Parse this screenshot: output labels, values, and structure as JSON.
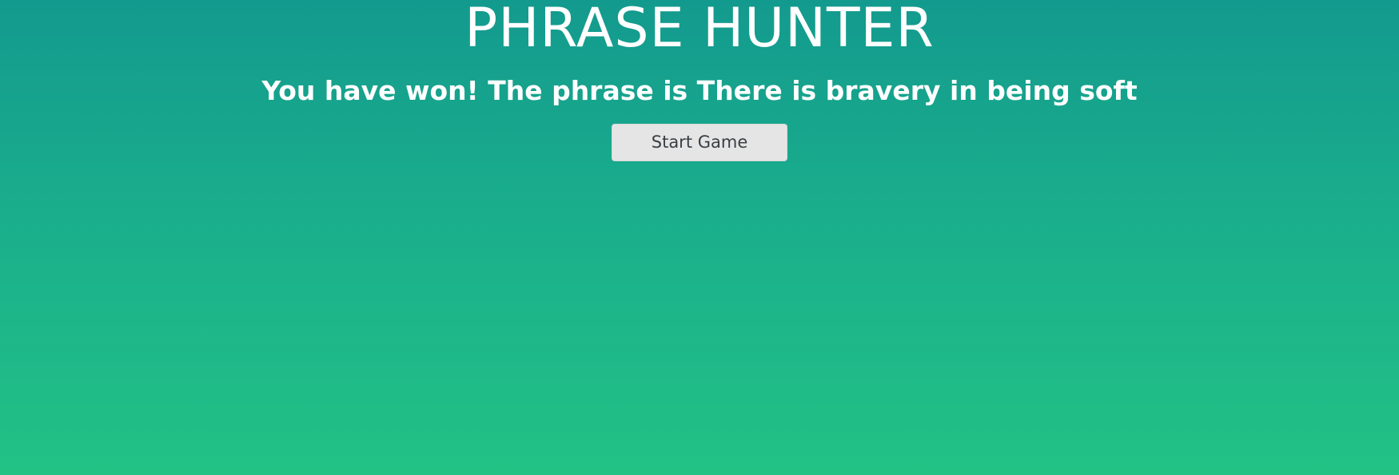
{
  "game": {
    "title": "PHRASE HUNTER",
    "message": "You have won! The phrase is There is bravery in being soft",
    "start_button_label": "Start Game"
  },
  "colors": {
    "background_top": "#139a8e",
    "background_bottom": "#22c285",
    "button_background": "#e5e5e5",
    "button_text": "#3a3f44",
    "text": "#ffffff"
  }
}
